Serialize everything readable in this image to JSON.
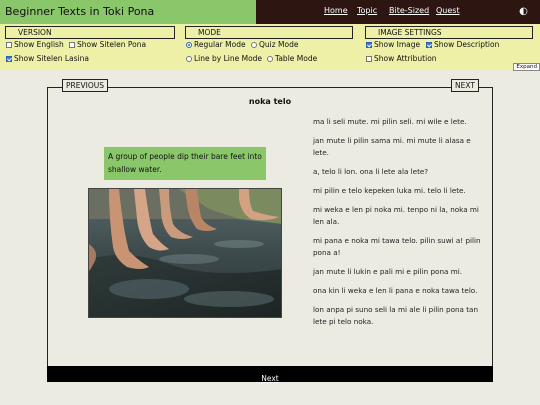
{
  "header": {
    "title": "Beginner Texts in Toki Pona",
    "nav": [
      "Home",
      "Topic",
      "Bite-Sized",
      "Quest"
    ],
    "theme_toggle_icon": "contrast-icon"
  },
  "settings": {
    "version": {
      "title": "VERSION",
      "options": [
        {
          "label": "Show English",
          "checked": false
        },
        {
          "label": "Show Sitelen Pona",
          "checked": false
        },
        {
          "label": "Show Sitelen Lasina",
          "checked": true
        }
      ]
    },
    "mode": {
      "title": "MODE",
      "options": [
        {
          "label": "Regular Mode",
          "selected": true
        },
        {
          "label": "Quiz Mode",
          "selected": false
        },
        {
          "label": "Line by Line Mode",
          "selected": false
        },
        {
          "label": "Table Mode",
          "selected": false
        }
      ]
    },
    "image": {
      "title": "IMAGE SETTINGS",
      "options": [
        {
          "label": "Show Image",
          "checked": true
        },
        {
          "label": "Show Description",
          "checked": true
        },
        {
          "label": "Show Attribution",
          "checked": false
        }
      ]
    },
    "expand_label": "Expand"
  },
  "story": {
    "previous_label": "PREVIOUS",
    "next_label": "NEXT",
    "title": "noka telo",
    "image_description": "A group of people dip their bare feet into shallow water.",
    "lines": [
      "ma li seli mute. mi pilin seli. mi wile e lete.",
      "jan mute li pilin sama mi. mi mute li alasa e lete.",
      "a, telo li lon. ona li lete ala lete?",
      "mi pilin e telo kepeken luka mi. telo li lete.",
      "mi weka e len pi noka mi. tenpo ni la, noka mi len ala.",
      "mi pana e noka mi tawa telo. pilin suwi a! pilin pona a!",
      "jan mute li lukin e pali mi e pilin pona mi.",
      "ona kin li weka e len li pana e noka tawa telo.",
      "lon anpa pi suno seli la mi ale li pilin pona tan lete pi telo noka."
    ],
    "footer_next": "Next"
  }
}
